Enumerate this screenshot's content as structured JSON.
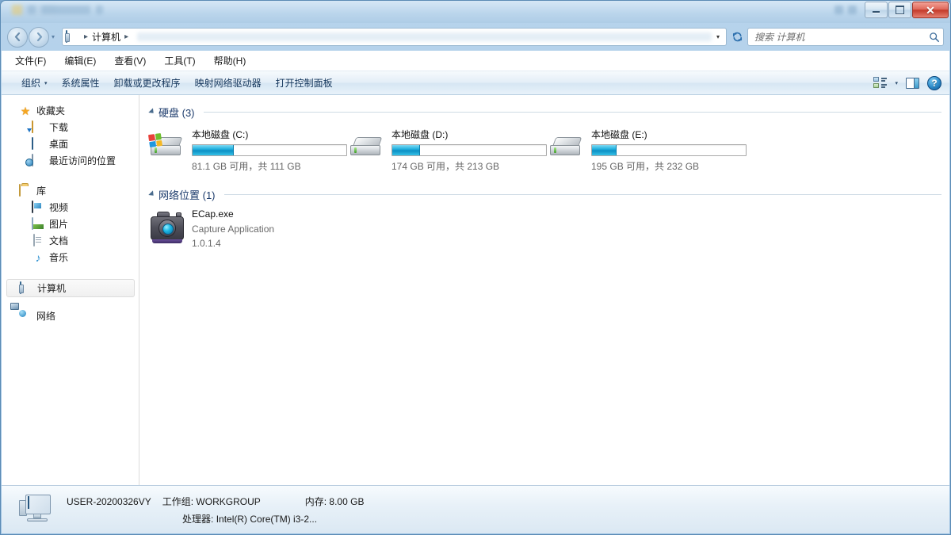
{
  "window": {
    "controls": {
      "minimize": "—",
      "maximize": "□",
      "close": "✕"
    }
  },
  "nav": {
    "back_icon": "back-arrow-icon",
    "forward_icon": "forward-arrow-icon",
    "history_caret": "▾",
    "breadcrumb": {
      "root_icon": "computer-icon",
      "sep": "▸",
      "label": "计算机",
      "trailing_sep": "▸"
    },
    "address_caret": "▾",
    "refresh_icon": "↻",
    "search": {
      "placeholder": "搜索 计算机",
      "value": "",
      "icon": "search-icon"
    }
  },
  "menubar": {
    "items": [
      {
        "label": "文件(F)"
      },
      {
        "label": "编辑(E)"
      },
      {
        "label": "查看(V)"
      },
      {
        "label": "工具(T)"
      },
      {
        "label": "帮助(H)"
      }
    ]
  },
  "commandbar": {
    "organize": {
      "label": "组织",
      "caret": "▾"
    },
    "buttons": [
      {
        "label": "系统属性"
      },
      {
        "label": "卸载或更改程序"
      },
      {
        "label": "映射网络驱动器"
      },
      {
        "label": "打开控制面板"
      }
    ],
    "view_caret": "▾",
    "help_label": "?"
  },
  "sidebar": {
    "groups": [
      {
        "header": {
          "label": "收藏夹",
          "icon": "star-icon"
        },
        "items": [
          {
            "label": "下载",
            "icon": "downloads-icon"
          },
          {
            "label": "桌面",
            "icon": "desktop-icon"
          },
          {
            "label": "最近访问的位置",
            "icon": "recent-places-icon"
          }
        ]
      },
      {
        "header": {
          "label": "库",
          "icon": "library-icon"
        },
        "items": [
          {
            "label": "视频",
            "icon": "video-icon"
          },
          {
            "label": "图片",
            "icon": "pictures-icon"
          },
          {
            "label": "文档",
            "icon": "documents-icon"
          },
          {
            "label": "音乐",
            "icon": "music-icon"
          }
        ]
      }
    ],
    "computer": {
      "label": "计算机",
      "icon": "computer-icon",
      "selected": true
    },
    "network": {
      "label": "网络",
      "icon": "network-icon"
    }
  },
  "content": {
    "sections": [
      {
        "title": "硬盘 (3)",
        "drives": [
          {
            "name": "本地磁盘 (C:)",
            "free_text": "81.1 GB 可用，共 111 GB",
            "free_gb": 81.1,
            "total_gb": 111,
            "used_percent": 27,
            "is_system": true,
            "icon": "hard-drive-icon"
          },
          {
            "name": "本地磁盘 (D:)",
            "free_text": "174 GB 可用，共 213 GB",
            "free_gb": 174,
            "total_gb": 213,
            "used_percent": 18,
            "is_system": false,
            "icon": "hard-drive-icon"
          },
          {
            "name": "本地磁盘 (E:)",
            "free_text": "195 GB 可用，共 232 GB",
            "free_gb": 195,
            "total_gb": 232,
            "used_percent": 16,
            "is_system": false,
            "icon": "hard-drive-icon"
          }
        ]
      },
      {
        "title": "网络位置 (1)",
        "items": [
          {
            "name": "ECap.exe",
            "description": "Capture Application",
            "version": "1.0.1.4",
            "icon": "camera-icon"
          }
        ]
      }
    ]
  },
  "statusbar": {
    "computer_name": "USER-20200326VY",
    "workgroup_label": "工作组:",
    "workgroup_value": "WORKGROUP",
    "memory_label": "内存:",
    "memory_value": "8.00 GB",
    "processor_label": "处理器:",
    "processor_value": "Intel(R) Core(TM) i3-2...",
    "icon": "computer-status-icon"
  },
  "colors": {
    "accent": "#1b3a6b",
    "bar_fill": "#23b2e0",
    "close_button": "#c33a29"
  }
}
